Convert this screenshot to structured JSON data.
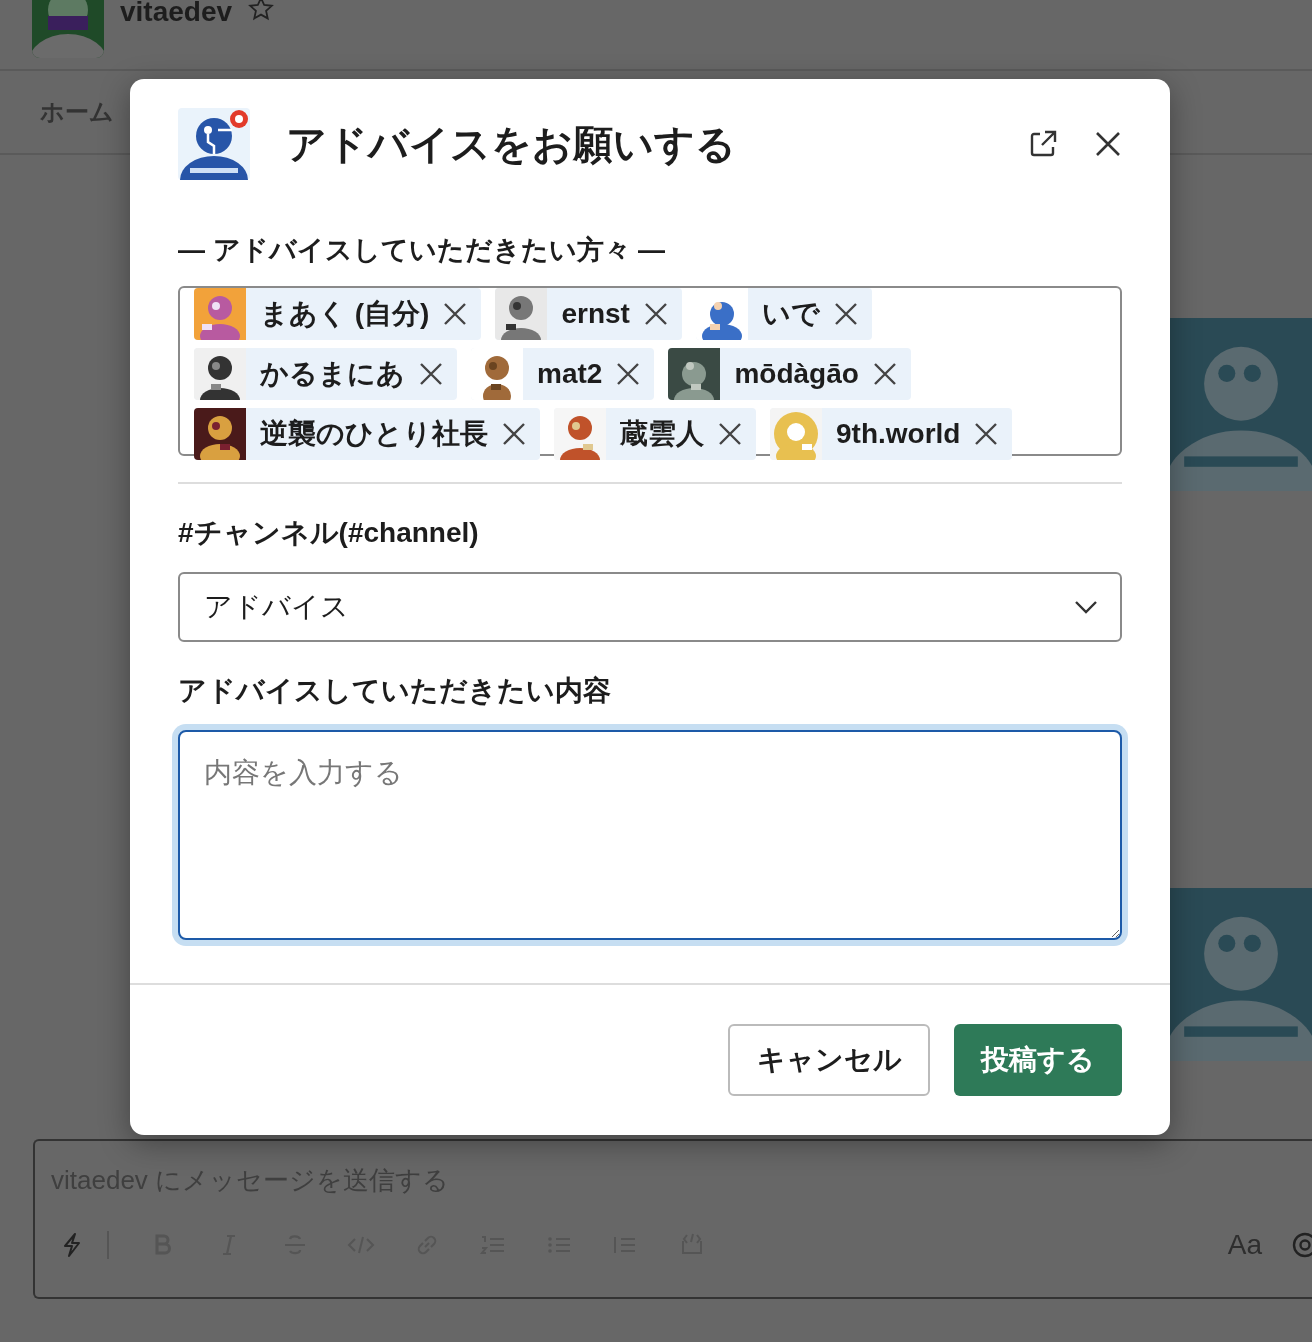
{
  "workspace": {
    "name": "vitaedev",
    "starred": false
  },
  "tabs": [
    {
      "label": "ホーム"
    }
  ],
  "composer": {
    "placeholder": "vitaedev にメッセージを送信する",
    "format_label": "Aa"
  },
  "modal": {
    "title": "アドバイスをお願いする",
    "people_label": "— アドバイスしていただきたい方々 —",
    "people": [
      {
        "name": "まあく (自分)"
      },
      {
        "name": "ernst"
      },
      {
        "name": "いで"
      },
      {
        "name": "かるまにあ"
      },
      {
        "name": "mat2"
      },
      {
        "name": "mōdàgāo"
      },
      {
        "name": "逆襲のひとり社長"
      },
      {
        "name": "蔵雲人"
      },
      {
        "name": "9th.world"
      }
    ],
    "channel_label": "#チャンネル(#channel)",
    "channel_value": "アドバイス",
    "content_label": "アドバイスしていただきたい内容",
    "content_placeholder": "内容を入力する",
    "buttons": [
      {
        "label": "キャンセル",
        "kind": "secondary"
      },
      {
        "label": "投稿する",
        "kind": "primary"
      }
    ]
  }
}
